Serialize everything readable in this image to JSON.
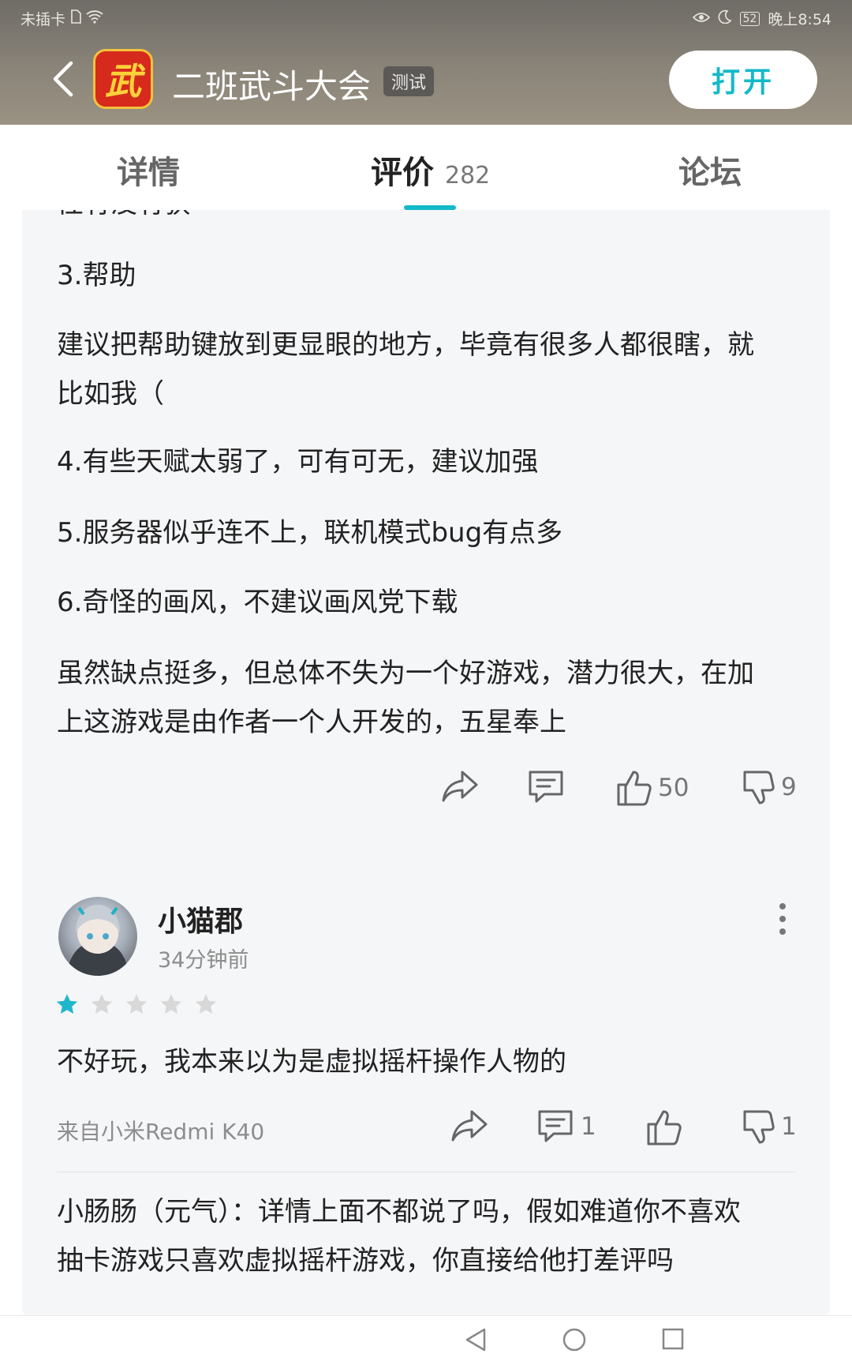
{
  "status_bar": {
    "carrier": "未插卡",
    "battery": "52",
    "time": "晚上8:54"
  },
  "header": {
    "logo_text": "武",
    "title": "二班武斗大会",
    "badge": "测试",
    "open_label": "打开"
  },
  "tabs": [
    {
      "label": "详情"
    },
    {
      "label": "评价",
      "count": "282"
    },
    {
      "label": "论坛"
    }
  ],
  "review1": {
    "partial_line": "性有没有获",
    "paragraphs": [
      "3.帮助",
      "建议把帮助键放到更显眼的地方，毕竟有很多人都很瞎，就比如我（",
      "4.有些天赋太弱了，可有可无，建议加强",
      "5.服务器似乎连不上，联机模式bug有点多",
      "6.奇怪的画风，不建议画风党下载",
      "虽然缺点挺多，但总体不失为一个好游戏，潜力很大，在加上这游戏是由作者一个人开发的，五星奉上"
    ],
    "likes": "50",
    "dislikes": "9"
  },
  "review2": {
    "username": "小猫郡",
    "time": "34分钟前",
    "rating": 1,
    "max_rating": 5,
    "text": "不好玩，我本来以为是虚拟摇杆操作人物的",
    "device": "来自小米Redmi K40",
    "comments": "1",
    "dislikes": "1",
    "reply": "小肠肠（元气）：详情上面不都说了吗，假如难道你不喜欢抽卡游戏只喜欢虚拟摇杆游戏，你直接给他打差评吗"
  },
  "colors": {
    "accent": "#14b9c8",
    "star_filled": "#1fb6cc",
    "star_empty": "#d8d8d8"
  }
}
